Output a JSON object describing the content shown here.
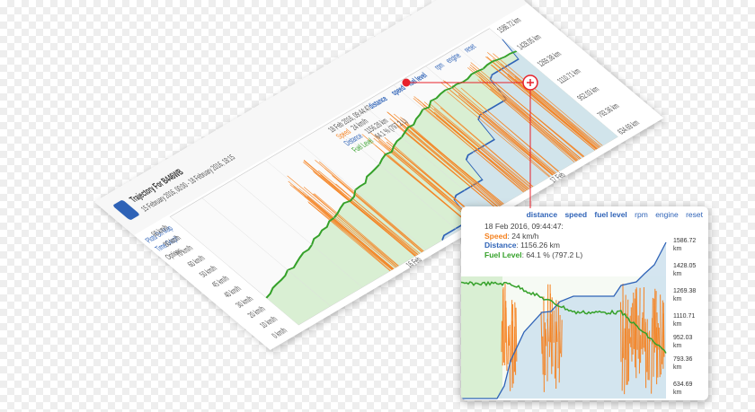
{
  "panel": {
    "title": "Trajectory For B446WB",
    "subtitle": "15 February 2016, 00:00 - 18 February 2016, 18:15",
    "menu": {
      "plots_on_map": "Plots On Map",
      "time_graph": "Time Graph",
      "options": "Options"
    },
    "links": [
      "distance",
      "speed",
      "fuel level",
      "rpm",
      "engine",
      "reset"
    ],
    "tooltip": {
      "date": "18 Feb 2016, 09:44:47",
      "speed_label": "Speed",
      "speed_value": "24 km/h",
      "distance_label": "Distance",
      "distance_value": "1156.26 km",
      "fuel_label": "Fuel Level",
      "fuel_value": "64.1 % (797.2 L)"
    },
    "speed_axis": [
      "90 km/h",
      "80 km/h",
      "70 km/h",
      "60 km/h",
      "50 km/h",
      "45 km/h",
      "40 km/h",
      "30 km/h",
      "20 km/h",
      "10 km/h",
      "0 km/h"
    ],
    "distance_axis": [
      "1586.72 km",
      "1428.05 km",
      "1269.38 km",
      "1110.71 km",
      "952.03 km",
      "793.36 km",
      "634.69 km"
    ],
    "date_labels": [
      "16 Feb",
      "17 Feb"
    ]
  },
  "zoom": {
    "links": [
      "distance",
      "speed",
      "fuel level",
      "rpm",
      "engine",
      "reset"
    ],
    "tooltip": {
      "date": "18 Feb 2016, 09:44:47:",
      "speed_label": "Speed",
      "speed_value": "24 km/h",
      "distance_label": "Distance",
      "distance_value": "1156.26 km",
      "fuel_label": "Fuel Level",
      "fuel_value": "64.1 % (797.2 L)"
    },
    "y_ticks": [
      "1586.72 km",
      "1428.05 km",
      "1269.38 km",
      "1110.71 km",
      "952.03 km",
      "793.36 km",
      "634.69 km"
    ]
  },
  "colors": {
    "speed": "#f58220",
    "distance": "#2f63b7",
    "fuel": "#35a12a",
    "fuel_fill": "#d9efd3",
    "distance_fill": "#cfe2ee",
    "marker": "#e8212b"
  }
}
